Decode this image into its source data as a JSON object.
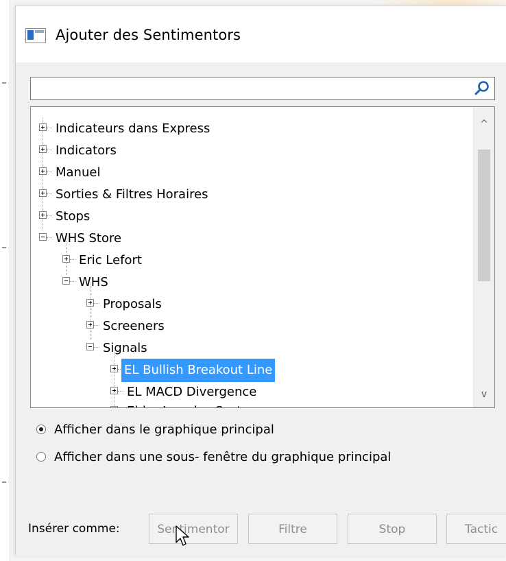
{
  "dialog": {
    "title": "Ajouter des Sentimentors",
    "title_icon": "window-app-icon"
  },
  "search": {
    "value": "",
    "icon": "search-icon"
  },
  "tree": {
    "items": [
      {
        "label": "Indicateurs dans Express",
        "expander": "plus",
        "level": 0
      },
      {
        "label": "Indicators",
        "expander": "plus",
        "level": 0
      },
      {
        "label": "Manuel",
        "expander": "plus",
        "level": 0
      },
      {
        "label": "Sorties & Filtres Horaires",
        "expander": "plus",
        "level": 0
      },
      {
        "label": "Stops",
        "expander": "plus",
        "level": 0
      },
      {
        "label": "WHS Store",
        "expander": "minus",
        "level": 0
      },
      {
        "label": "Eric Lefort",
        "expander": "plus",
        "level": 1
      },
      {
        "label": "WHS",
        "expander": "minus",
        "level": 1
      },
      {
        "label": "Proposals",
        "expander": "plus",
        "level": 2
      },
      {
        "label": "Screeners",
        "expander": "plus",
        "level": 2
      },
      {
        "label": "Signals",
        "expander": "minus",
        "level": 2
      },
      {
        "label": "EL Bullish Breakout Line",
        "expander": "plus",
        "level": 3,
        "selected": true
      },
      {
        "label": "EL MACD Divergence",
        "expander": "plus",
        "level": 3
      },
      {
        "label": "Elder Impulse System",
        "expander": "plus",
        "level": 3,
        "partially_visible": true
      }
    ],
    "scroll_up_glyph": "^",
    "scroll_down_glyph": "v"
  },
  "options": {
    "radio_main": "Afficher dans le graphique principal",
    "radio_sub": "Afficher dans une sous- fenêtre du graphique principal",
    "selected": "radio_main"
  },
  "insert": {
    "label": "Insérer comme:",
    "buttons": [
      "Sentimentor",
      "Filtre",
      "Stop",
      "Tactic"
    ]
  },
  "colors": {
    "selection": "#3399ff",
    "disabled_text": "#8e8e8e",
    "icon_blue": "#2b6cc4"
  }
}
